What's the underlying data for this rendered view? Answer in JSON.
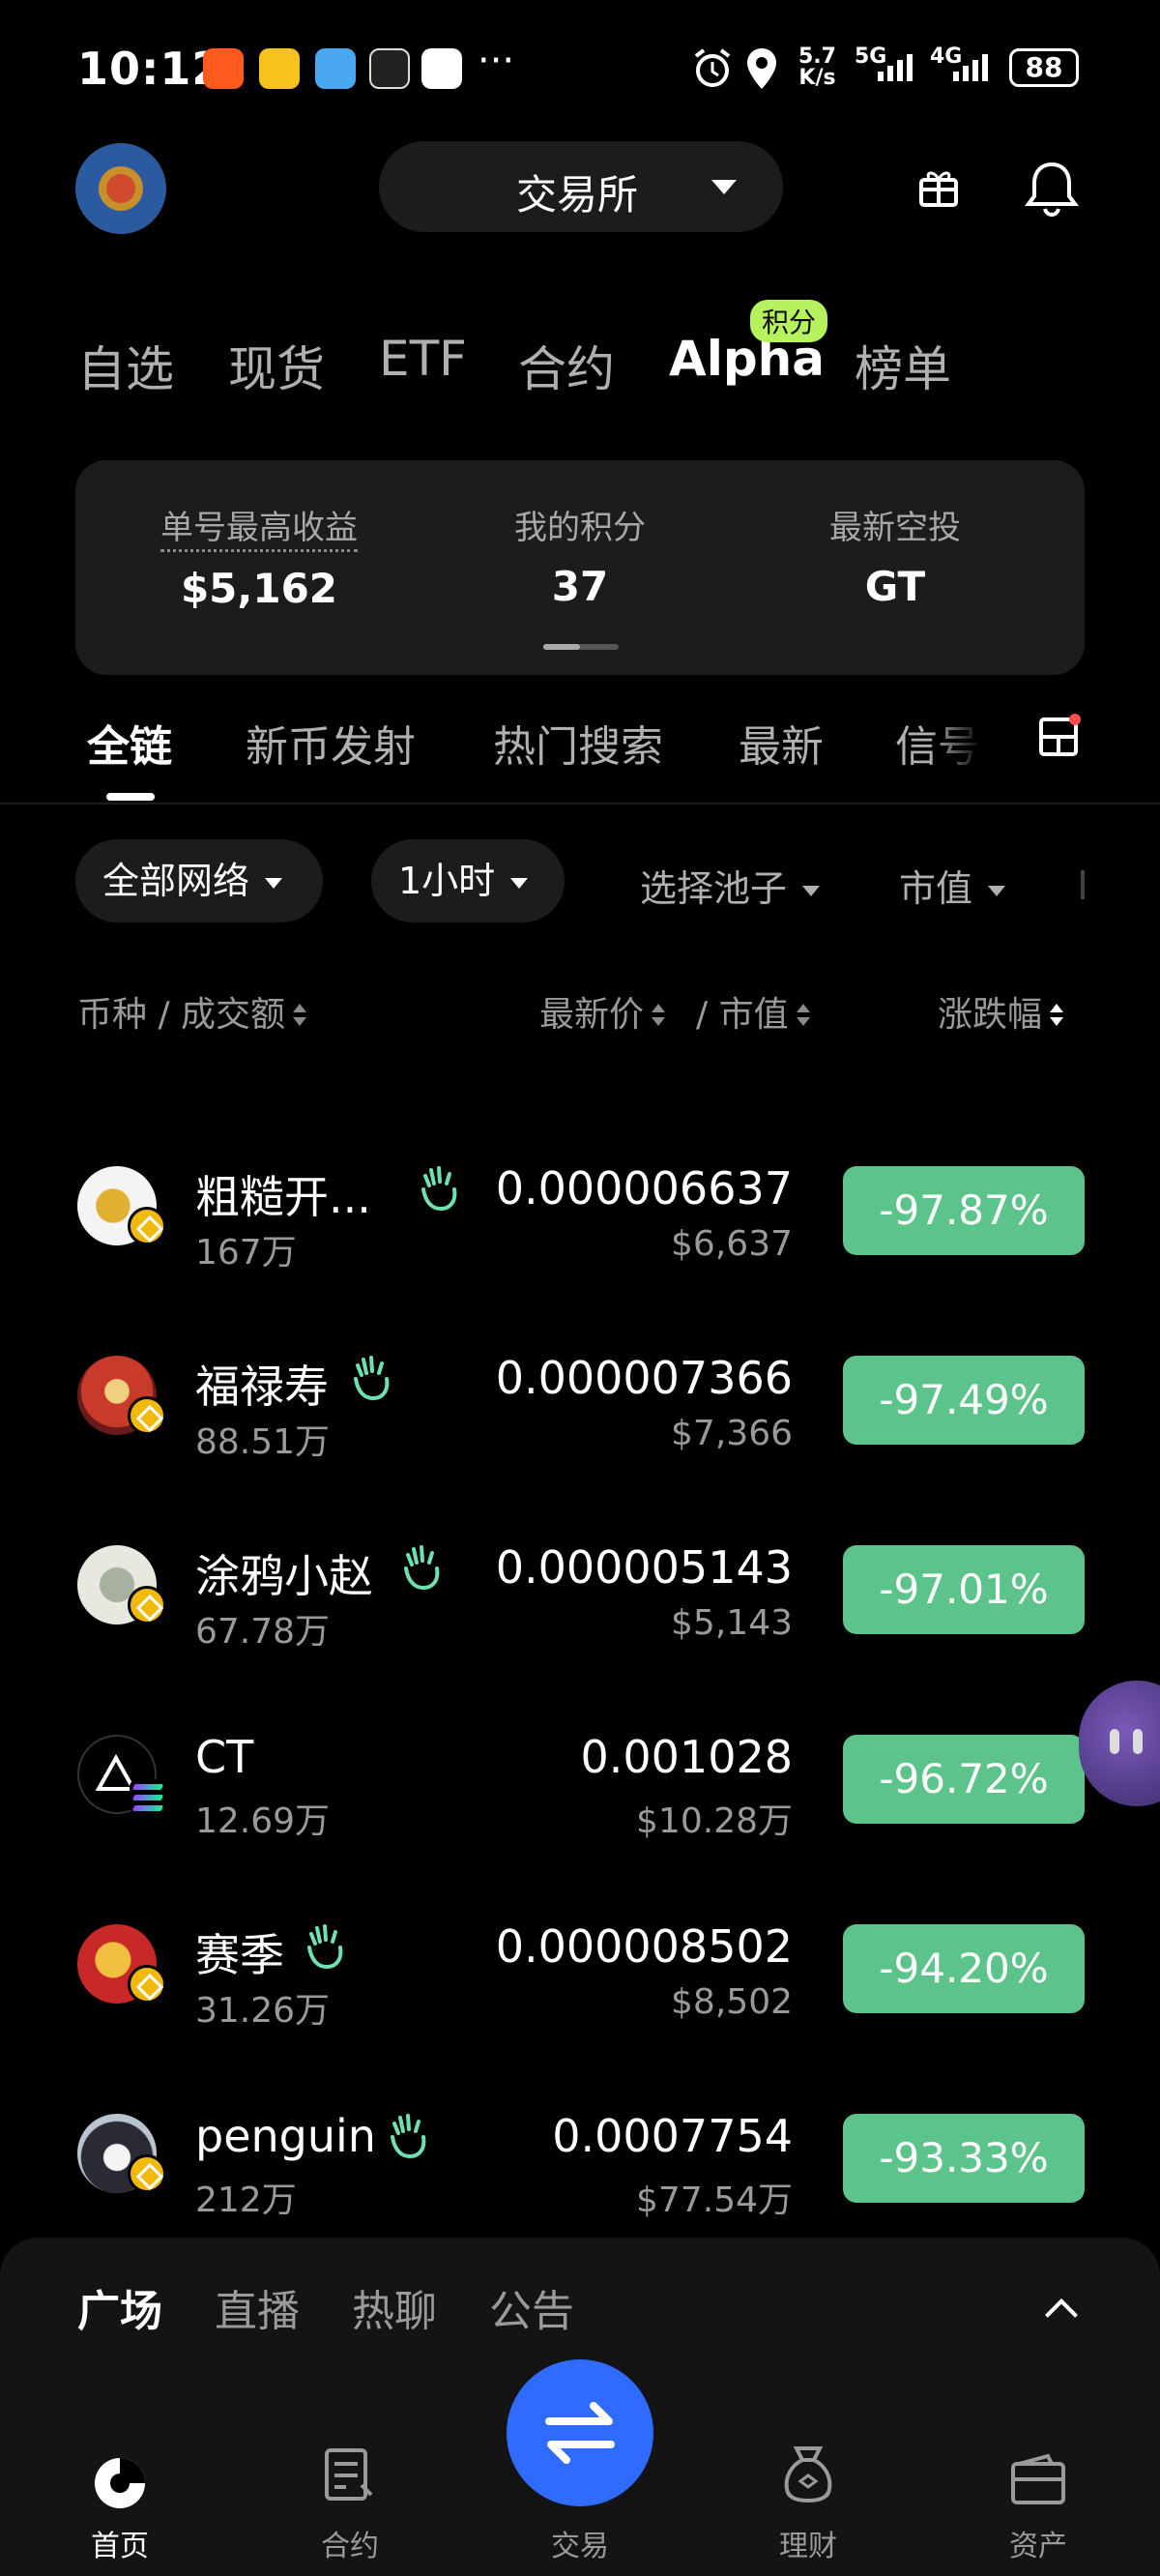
{
  "status_bar": {
    "time": "10:12",
    "net_speed_top": "5.7",
    "net_speed_bottom": "K/s",
    "sig1": "5G",
    "sig2": "4G",
    "battery": "88"
  },
  "header": {
    "exchange_label": "交易所"
  },
  "top_tabs": [
    "自选",
    "现货",
    "ETF",
    "合约",
    "Alpha",
    "榜单"
  ],
  "top_tabs_active": "Alpha",
  "alpha_badge": "积分",
  "stats": {
    "max_profit_label": "单号最高收益",
    "max_profit_value": "$5,162",
    "points_label": "我的积分",
    "points_value": "37",
    "airdrop_label": "最新空投",
    "airdrop_value": "GT"
  },
  "chain_tabs": [
    "全链",
    "新币发射",
    "热门搜索",
    "最新",
    "信号"
  ],
  "filters": {
    "network": "全部网络",
    "timeframe": "1小时",
    "pool": "选择池子",
    "mcap": "市值"
  },
  "columns": {
    "token": "币种 / 成交额",
    "price": "最新价",
    "mcap": "/ 市值",
    "change": "涨跌幅"
  },
  "rows": [
    {
      "name": "粗糙开...",
      "volume": "167万",
      "price": "0.000006637",
      "mcap": "$6,637",
      "change": "-97.87%",
      "chain": "bnb"
    },
    {
      "name": "福禄寿",
      "volume": "88.51万",
      "price": "0.000007366",
      "mcap": "$7,366",
      "change": "-97.49%",
      "chain": "bnb"
    },
    {
      "name": "涂鸦小赵",
      "volume": "67.78万",
      "price": "0.000005143",
      "mcap": "$5,143",
      "change": "-97.01%",
      "chain": "bnb"
    },
    {
      "name": "CT",
      "volume": "12.69万",
      "price": "0.001028",
      "mcap": "$10.28万",
      "change": "-96.72%",
      "chain": "solana"
    },
    {
      "name": "赛季",
      "volume": "31.26万",
      "price": "0.000008502",
      "mcap": "$8,502",
      "change": "-94.20%",
      "chain": "bnb"
    },
    {
      "name": "penguin",
      "volume": "212万",
      "price": "0.0007754",
      "mcap": "$77.54万",
      "change": "-93.33%",
      "chain": "bnb"
    }
  ],
  "sheet_tabs": [
    "广场",
    "直播",
    "热聊",
    "公告"
  ],
  "bottom_nav": [
    "首页",
    "合约",
    "交易",
    "理财",
    "资产"
  ],
  "colors": {
    "up_down_green": "#5cc48a",
    "accent_blue": "#2f6bff",
    "badge_lime": "#b6f25e"
  }
}
